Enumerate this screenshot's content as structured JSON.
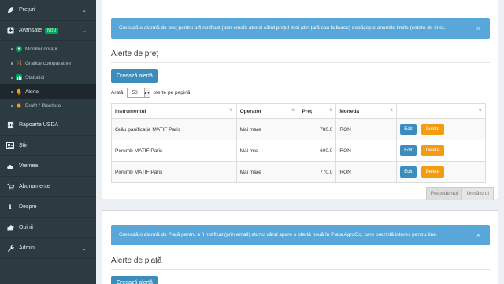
{
  "sidebar": {
    "items_top": [
      {
        "label": "Prețuri",
        "icon": "leaf-icon"
      },
      {
        "label": "Avansate",
        "icon": "plus-square-icon",
        "badge": "NOU"
      }
    ],
    "submenu": [
      {
        "label": "Monitor cotații",
        "icon": "monitor-icon",
        "color": "#00a65a"
      },
      {
        "label": "Grafice comparative",
        "icon": "shuffle-icon",
        "color": "#f39c12"
      },
      {
        "label": "Statistici",
        "icon": "bar-chart-icon",
        "color": "#00a65a"
      },
      {
        "label": "Alerte",
        "icon": "bell-icon",
        "color": "#f39c12"
      },
      {
        "label": "Profit / Pierdere",
        "icon": "dot-icon",
        "color": "#f39c12"
      }
    ],
    "items_bottom": [
      {
        "label": "Rapoarte USDA",
        "icon": "report-icon"
      },
      {
        "label": "Știri",
        "icon": "newspaper-icon"
      },
      {
        "label": "Vremea",
        "icon": "cloud-icon"
      },
      {
        "label": "Abonamente",
        "icon": "cart-icon"
      },
      {
        "label": "Despre",
        "icon": "info-icon"
      },
      {
        "label": "Opinii",
        "icon": "thumbs-up-icon"
      },
      {
        "label": "Admin",
        "icon": "wrench-icon"
      }
    ]
  },
  "price_alerts": {
    "info": "Creează o alarmă de preț pentru a fi notificat (prin email) atunci când prețul zilei (din țară sau la burse) depășește anumite limite (setate de tine).",
    "close": "×",
    "title": "Alerte de preț",
    "create_button": "Creează alertă",
    "length_prefix": "Arată",
    "length_value": "50",
    "length_suffix": "oferte pe pagină",
    "columns": [
      "Instrumentul",
      "Operator",
      "Preț",
      "Moneda",
      ""
    ],
    "rows": [
      {
        "instrument": "Grâu panificație MATIF Paris",
        "operator": "Mai mare",
        "price": "780.0",
        "currency": "RON"
      },
      {
        "instrument": "Porumb MATIF Paris",
        "operator": "Mai mic",
        "price": "600.0",
        "currency": "RON"
      },
      {
        "instrument": "Porumb MATIF Paris",
        "operator": "Mai mare",
        "price": "770.0",
        "currency": "RON"
      }
    ],
    "edit_label": "Edit",
    "delete_label": "Delete",
    "prev": "Precedentul",
    "next": "Următorul"
  },
  "market_alerts": {
    "info": "Creează o alarmă de Piață pentru a fi notificat (prin email) atunci când apare o ofertă nouă în Piața AgroGo, care prezintă interes pentru tine.",
    "close": "×",
    "title": "Alerte de piață",
    "create_button": "Creează alertă"
  },
  "colors": {
    "primary": "#3c8dbc",
    "warning": "#f39c12",
    "success": "#00a65a",
    "sidebar": "#2c3b41"
  }
}
